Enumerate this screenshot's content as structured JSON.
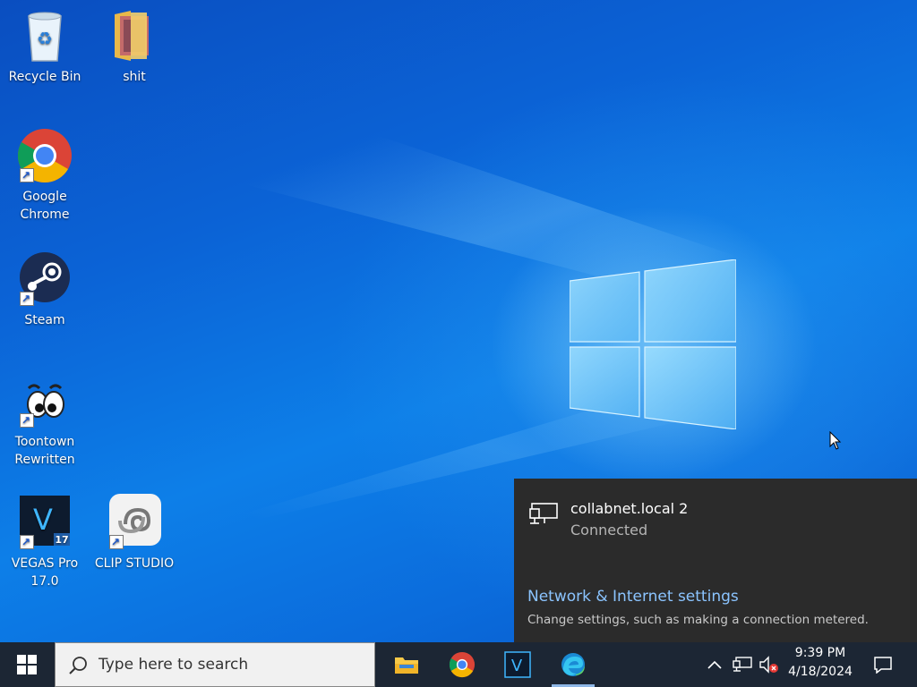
{
  "desktop": {
    "icons": [
      {
        "id": "recycle-bin",
        "label": "Recycle Bin"
      },
      {
        "id": "folder",
        "label": "shit"
      },
      {
        "id": "chrome",
        "label": "Google Chrome"
      },
      {
        "id": "steam",
        "label": "Steam"
      },
      {
        "id": "toontown",
        "label": "Toontown Rewritten"
      },
      {
        "id": "vegas",
        "label": "VEGAS Pro 17.0"
      },
      {
        "id": "clip-studio",
        "label": "CLIP STUDIO"
      }
    ]
  },
  "network_flyout": {
    "network_name": "collabnet.local 2",
    "status": "Connected",
    "settings_link": "Network & Internet settings",
    "settings_desc": "Change settings, such as making a connection metered."
  },
  "taskbar": {
    "search_placeholder": "Type here to search",
    "apps": [
      "file-explorer-icon",
      "chrome-icon",
      "vegas-icon",
      "edge-icon"
    ],
    "time": "9:39 PM",
    "date": "4/18/2024"
  },
  "colors": {
    "accent": "#0b63d6",
    "taskbar": "#1c2634",
    "flyout": "#2b2b2b",
    "link": "#8bc4ff"
  }
}
